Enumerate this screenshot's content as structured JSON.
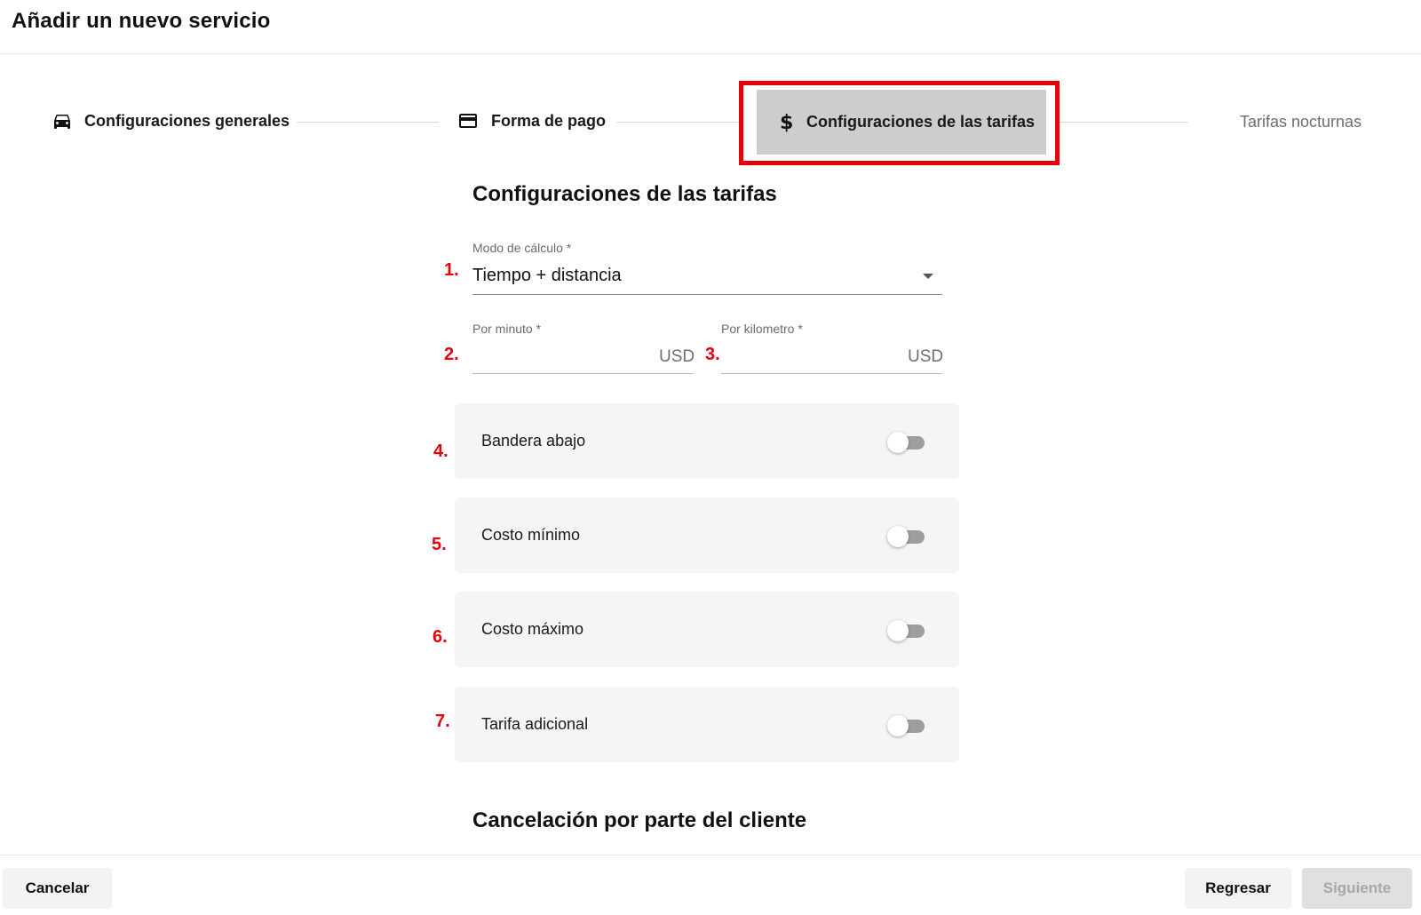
{
  "header": {
    "title": "Añadir un nuevo servicio"
  },
  "stepper": {
    "steps": [
      {
        "label": "Configuraciones generales",
        "icon": "car-icon",
        "state": "completed"
      },
      {
        "label": "Forma de pago",
        "icon": "credit-card-icon",
        "state": "completed"
      },
      {
        "label": "Configuraciones de las tarifas",
        "icon": "dollar-icon",
        "state": "active"
      },
      {
        "label": "Tarifas nocturnas",
        "icon": "moon-icon",
        "state": "pending"
      }
    ]
  },
  "form": {
    "section_title": "Configuraciones de las tarifas",
    "calc_mode": {
      "label": "Modo de cálculo *",
      "value": "Tiempo + distancia"
    },
    "per_minute": {
      "label": "Por minuto *",
      "value": "",
      "suffix": "USD"
    },
    "per_km": {
      "label": "Por kilometro *",
      "value": "",
      "suffix": "USD"
    },
    "toggles": [
      {
        "label": "Bandera abajo",
        "checked": false
      },
      {
        "label": "Costo mínimo",
        "checked": false
      },
      {
        "label": "Costo máximo",
        "checked": false
      },
      {
        "label": "Tarifa adicional",
        "checked": false
      }
    ],
    "next_section_title": "Cancelación por parte del cliente"
  },
  "annotations": {
    "markers": [
      "1.",
      "2.",
      "3.",
      "4.",
      "5.",
      "6.",
      "7."
    ],
    "color": "#e8000b"
  },
  "footer": {
    "cancel_label": "Cancelar",
    "back_label": "Regresar",
    "next_label": "Siguiente"
  },
  "colors": {
    "active_step_bg": "#cdcdcd",
    "card_bg": "#f5f5f5",
    "highlight": "#e8000b"
  }
}
